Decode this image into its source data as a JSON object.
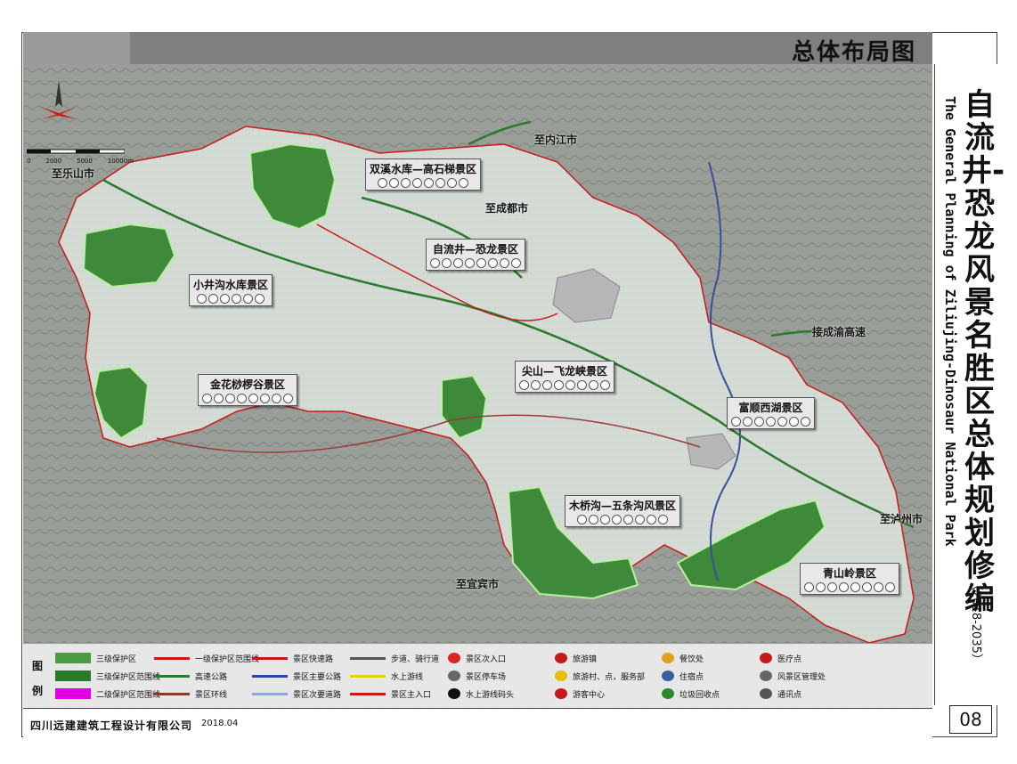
{
  "header": {
    "title": "总体布局图"
  },
  "side": {
    "title": "自流井-恐龙风景名胜区总体规划修编",
    "title_en": "The General Planning of Ziliujing-Dinosaur National Park",
    "years": "（2018-2035）",
    "page": "08"
  },
  "footer": {
    "company": "四川远建建筑工程设计有限公司",
    "date": "2018.04"
  },
  "scale": {
    "labels": [
      "0",
      "2000",
      "5000",
      "10000m"
    ]
  },
  "places": {
    "leshan": "至乐山市",
    "neijiang": "至内江市",
    "chengdu": "至成都市",
    "yibin": "至宜宾市",
    "luzhou": "至泸州市",
    "yuhigh": "接成渝高速"
  },
  "areas": [
    {
      "name": "双溪水库—高石梯景区"
    },
    {
      "name": "自流井—恐龙景区"
    },
    {
      "name": "小井沟水库景区"
    },
    {
      "name": "金花桫椤谷景区"
    },
    {
      "name": "尖山—飞龙峡景区"
    },
    {
      "name": "富顺西湖景区"
    },
    {
      "name": "木桥沟—五条沟风景区"
    },
    {
      "name": "青山岭景区"
    }
  ],
  "legend": {
    "title_a": "图",
    "title_b": "例",
    "items": [
      "三级保护区",
      "一级保护区范围线",
      "景区快速路",
      "步道、骑行道",
      "景区次入口",
      "旅游镇",
      "餐饮处",
      "医疗点",
      "三级保护区范围线",
      "高速公路",
      "景区主要公路",
      "水上游线",
      "景区停车场",
      "旅游村、点，服务部",
      "住宿点",
      "风景区管理处",
      "二级保护区范围线",
      "景区环线",
      "景区次要道路",
      "景区主入口",
      "水上游线码头",
      "游客中心",
      "垃圾回收点",
      "通讯点"
    ]
  }
}
